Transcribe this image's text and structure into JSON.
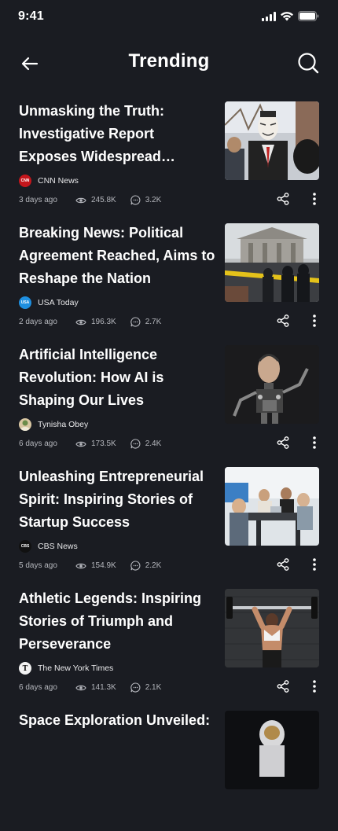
{
  "status_bar": {
    "time": "9:41"
  },
  "header": {
    "title": "Trending"
  },
  "articles": [
    {
      "title": "Unmasking the Truth: Investigative Report Exposes Widespread Political Corruption",
      "source": "CNN News",
      "source_logo_text": "CNN",
      "source_color": "#c4161c",
      "age": "3 days ago",
      "views": "245.8K",
      "comments": "3.2K"
    },
    {
      "title": "Breaking News: Political Agreement Reached, Aims to Reshape the Nation",
      "source": "USA Today",
      "source_logo_text": "USA",
      "source_color": "#1e8fe0",
      "age": "2 days ago",
      "views": "196.3K",
      "comments": "2.7K"
    },
    {
      "title": "Artificial Intelligence Revolution: How AI is Shaping Our Lives",
      "source": "Tynisha Obey",
      "source_logo_text": "",
      "source_color": "#d9c7a3",
      "age": "6 days ago",
      "views": "173.5K",
      "comments": "2.4K"
    },
    {
      "title": "Unleashing Entrepreneurial Spirit: Inspiring Stories of Startup Success",
      "source": "CBS News",
      "source_logo_text": "CBS",
      "source_color": "#111111",
      "age": "5 days ago",
      "views": "154.9K",
      "comments": "2.2K"
    },
    {
      "title": "Athletic Legends: Inspiring Stories of Triumph and Perseverance",
      "source": "The New York Times",
      "source_logo_text": "T",
      "source_color": "#f2f2f2",
      "age": "6 days ago",
      "views": "141.3K",
      "comments": "2.1K"
    },
    {
      "title": "Space Exploration Unveiled:",
      "source": "",
      "source_logo_text": "",
      "source_color": "#888888",
      "age": "",
      "views": "",
      "comments": ""
    }
  ]
}
